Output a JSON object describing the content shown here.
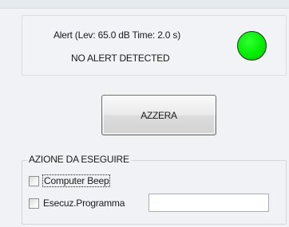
{
  "alert_panel": {
    "settings_text": "Alert (Lev: 65.0 dB Time: 2.0 s)",
    "status_text": "NO ALERT DETECTED",
    "indicator_color": "#00ee00"
  },
  "reset_button": {
    "label": "AZZERA"
  },
  "action_group": {
    "title": "AZIONE DA ESEGUIRE",
    "computer_beep_label": "Computer Beep",
    "run_program_label": "Esecuz.Programma",
    "program_path_value": ""
  }
}
